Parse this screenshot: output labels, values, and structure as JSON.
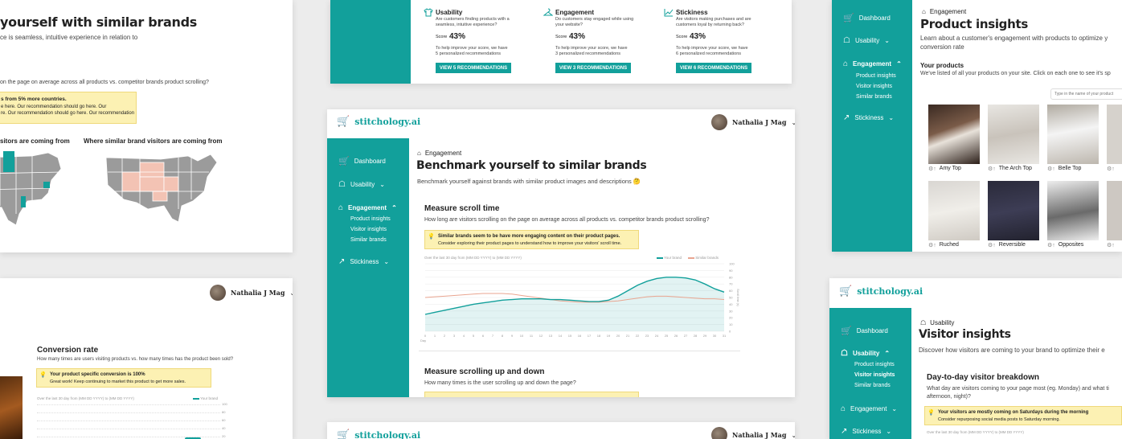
{
  "app": {
    "logo": "stitchology.ai",
    "user": "Nathalia J Mag"
  },
  "nav": {
    "dashboard": "Dashboard",
    "usability": "Usability",
    "engagement": "Engagement",
    "stickiness": "Stickiness",
    "sub": [
      "Product insights",
      "Visitor insights",
      "Similar brands"
    ]
  },
  "top_left": {
    "title": "yourself with similar brands",
    "subtitle": "ce is seamless, intuitive experience in relation to",
    "question": "on the page on average across all products vs. competitor brands product scrolling?",
    "note_title": "s from 5% more countries.",
    "note_lines": [
      "e here. Our recommendation should go here. Our",
      "re. Our recommendation should go here. Our recommendation"
    ],
    "map1_title": "sitors are coming from",
    "map2_title": "Where similar brand visitors are coming from"
  },
  "top_center": {
    "cols": [
      {
        "title": "Usability",
        "q": [
          "Are customers finding products with a",
          "seamless, intuitive experience?"
        ],
        "score_label": "Score",
        "score": "43%",
        "help": [
          "To help improve your score, we have",
          "5 personalized recommendations"
        ],
        "btn": "VIEW 5 RECOMMENDATIONS",
        "icon": "shirt-icon"
      },
      {
        "title": "Engagement",
        "q": [
          "Do customers stay engaged while using",
          "your website?"
        ],
        "score_label": "Score",
        "score": "43%",
        "help": [
          "To help improve your score, we have",
          "3 personalized recommendations"
        ],
        "btn": "VIEW 3 RECOMMENDATIONS",
        "icon": "hanger-icon"
      },
      {
        "title": "Stickiness",
        "q": [
          "Are visitors making purchases and are",
          "customers loyal by returning back?"
        ],
        "score_label": "Score",
        "score": "43%",
        "help": [
          "To help improve your score, we have",
          "6 personalized recommendations"
        ],
        "btn": "VIEW 6 RECOMMENDATIONS",
        "icon": "trend-icon"
      }
    ]
  },
  "top_right": {
    "crumb": "Engagement",
    "title": "Product insights",
    "desc": [
      "Learn about a customer's engagement with products to optimize y",
      "conversion rate"
    ],
    "section": "Your products",
    "section_desc": "We've listed of all your products on your site. Click on each one to see it's sp",
    "search_placeholder": "Type in the name of your product",
    "products": [
      "Amy Top",
      "The Arch Top",
      "Belle Top",
      "",
      "Ruched",
      "Reversible",
      "Opposites",
      ""
    ]
  },
  "center": {
    "crumb": "Engagement",
    "title": "Benchmark yourself to similar brands",
    "desc": "Benchmark yourself against brands with similar product images and descriptions",
    "section1": "Measure scroll time",
    "question1": "How long are visitors scrolling on the page on average across all products vs. competitor brands product scrolling?",
    "note_title": "Similar brands seem to be have more engaging content on their product pages.",
    "note_body": "Consider exploring their product pages to understand how to improve your visitors' scroll time.",
    "chart_caption": "Over the last 30 day from (MM DD YYYY) to (MM DD YYYY)",
    "legend": [
      "Your brand",
      "Similar brands"
    ],
    "y_axis_label": "Scroll time (s)",
    "x_axis_label": "Day",
    "section2": "Measure scrolling up and down",
    "question2": "How many times is the user scrolling up and down the page?"
  },
  "chart_data": {
    "type": "area",
    "title": "",
    "xlabel": "Day",
    "ylabel": "Scroll time (s)",
    "x": [
      "0",
      "1",
      "2",
      "3",
      "4",
      "5",
      "6",
      "7",
      "8",
      "9",
      "10",
      "11",
      "12",
      "13",
      "14",
      "15",
      "16",
      "17",
      "18",
      "19",
      "20",
      "21",
      "22",
      "23",
      "24",
      "25",
      "26",
      "27",
      "28",
      "29",
      "30",
      "31"
    ],
    "yticks": [
      "0",
      "10",
      "20",
      "30",
      "40",
      "50",
      "60",
      "70",
      "80",
      "90",
      "100"
    ],
    "ylim": [
      0,
      100
    ],
    "series": [
      {
        "name": "Your brand",
        "color": "#12a09b",
        "values": [
          25,
          28,
          31,
          34,
          37,
          40,
          42,
          44,
          46,
          47,
          48,
          48,
          48,
          47,
          47,
          46,
          45,
          44,
          44,
          46,
          52,
          60,
          68,
          74,
          78,
          80,
          80,
          79,
          76,
          70,
          63,
          58
        ]
      },
      {
        "name": "Similar brands",
        "color": "#e9a590",
        "values": [
          50,
          51,
          52,
          53,
          54,
          55,
          56,
          56,
          56,
          55,
          53,
          51,
          49,
          47,
          45,
          44,
          43,
          43,
          43,
          44,
          45,
          47,
          49,
          51,
          52,
          52,
          51,
          50,
          49,
          48,
          48,
          47
        ]
      }
    ],
    "grid": true,
    "legend_position": "top-right"
  },
  "bottom_left": {
    "title": "Conversion rate",
    "question": "How many times are users visiting products vs. how many times has the product been sold?",
    "note_title": "Your product specific conversion is 100%",
    "note_body": "Great work! Keep continuing to market this product to get more sales.",
    "caption": "Over the last 30 day from (MM DD YYYY) to (MM DD YYYY)",
    "legend": "Your brand",
    "yticks": [
      "100",
      "80",
      "60",
      "40",
      "20"
    ]
  },
  "bottom_right": {
    "crumb": "Usability",
    "title": "Visitor insights",
    "desc": "Discover how visitors are coming to your brand to optimize their e",
    "section": "Day-to-day visitor breakdown",
    "question": [
      "What day are visitors coming to your page most (eg. Monday) and what ti",
      "afternoon, night)?"
    ],
    "note_title": "Your visitors are mostly coming on Saturdays during the morning",
    "note_body": "Consider repurposing social media posts to Saturday morning.",
    "caption": "Over the last 30 day from (MM DD YYYY) to (MM DD YYYY)"
  }
}
